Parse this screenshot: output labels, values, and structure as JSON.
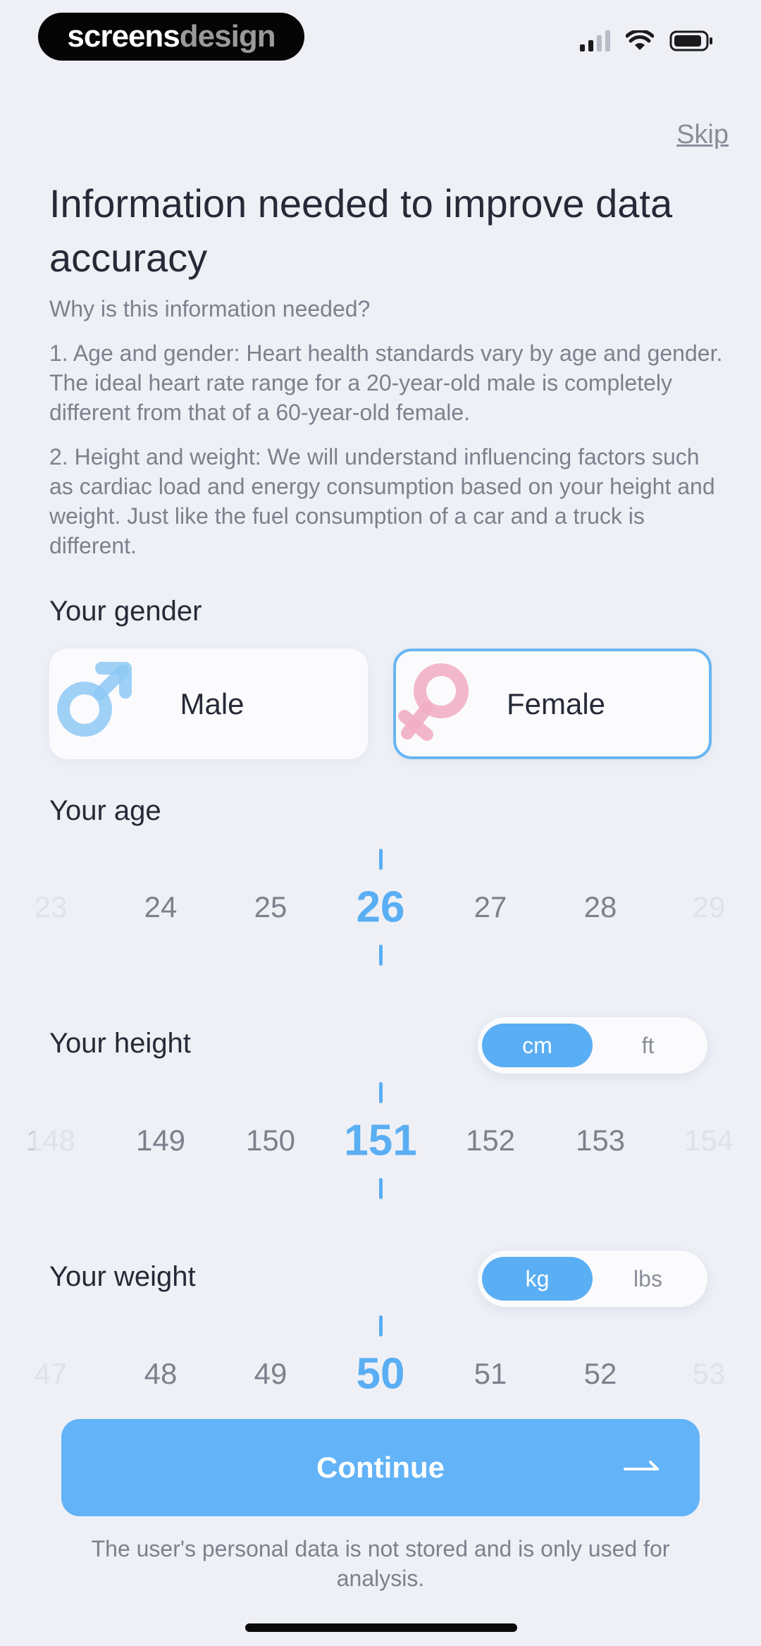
{
  "watermark": {
    "part_a": "screens",
    "part_b": "design"
  },
  "status_bar": {
    "icons": [
      "signal-icon",
      "wifi-icon",
      "battery-icon"
    ]
  },
  "header": {
    "skip_label": "Skip"
  },
  "title": "Information needed to improve data accuracy",
  "why_heading": "Why is this information needed?",
  "reasons": [
    "1. Age and gender: Heart health standards vary by age and gender. The ideal heart rate range for a 20-year-old male is completely different from that of a 60-year-old female.",
    "2. Height and weight: We will understand influencing factors such as cardiac load and energy consumption based on your height and weight. Just like the fuel consumption of a car and a truck is different."
  ],
  "gender": {
    "label": "Your gender",
    "options": [
      {
        "label": "Male",
        "icon": "male-symbol-icon",
        "selected": false
      },
      {
        "label": "Female",
        "icon": "female-symbol-icon",
        "selected": true
      }
    ]
  },
  "age": {
    "label": "Your age",
    "values": [
      "23",
      "24",
      "25",
      "26",
      "27",
      "28",
      "29"
    ],
    "selected": "26"
  },
  "height": {
    "label": "Your height",
    "units": [
      "cm",
      "ft"
    ],
    "selected_unit": "cm",
    "values": [
      "148",
      "149",
      "150",
      "151",
      "152",
      "153",
      "154"
    ],
    "selected": "151"
  },
  "weight": {
    "label": "Your weight",
    "units": [
      "kg",
      "lbs"
    ],
    "selected_unit": "kg",
    "values": [
      "47",
      "48",
      "49",
      "50",
      "51",
      "52",
      "53"
    ],
    "selected": "50"
  },
  "continue_label": "Continue",
  "footnote": "The user's personal data is not stored and is only used for analysis.",
  "colors": {
    "accent": "#5aaef3",
    "button": "#62b3f7",
    "background": "#eef0f6",
    "female": "#f0a6bf",
    "male": "#7ec0f4"
  }
}
